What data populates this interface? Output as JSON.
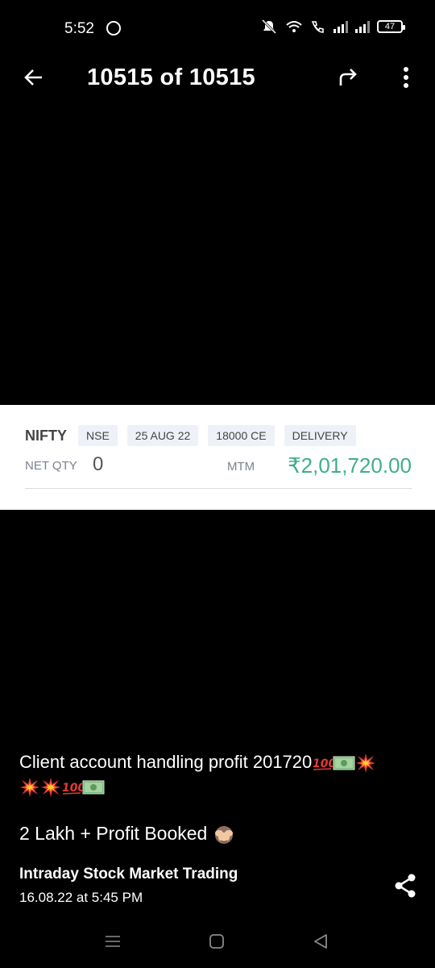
{
  "status_bar": {
    "time": "5:52",
    "battery": "47"
  },
  "header": {
    "title": "10515 of 10515"
  },
  "position_card": {
    "symbol": "NIFTY",
    "tags": [
      "NSE",
      "25 AUG 22",
      "18000 CE",
      "DELIVERY"
    ],
    "net_qty_label": "NET QTY",
    "net_qty_value": "0",
    "mtm_label": "MTM",
    "mtm_value": "₹2,01,720.00",
    "mtm_color": "#3fae8c"
  },
  "caption": {
    "line1_text": "Client account handling profit 201720",
    "line1_emojis": [
      "hundred-points-emoji",
      "dollar-banknote-emoji",
      "collision-emoji"
    ],
    "line2_emojis": [
      "collision-emoji",
      "collision-emoji",
      "hundred-points-emoji",
      "dollar-banknote-emoji"
    ],
    "line3_text": "2 Lakh + Profit Booked",
    "line3_emoji": "see-no-evil-monkey-emoji"
  },
  "post": {
    "title": "Intraday Stock Market Trading",
    "date": "16.08.22 at 5:45 PM"
  },
  "icons": {
    "back": "arrow-left-icon",
    "forward": "forward-arrow-icon",
    "more": "more-vertical-icon",
    "share": "share-icon"
  }
}
